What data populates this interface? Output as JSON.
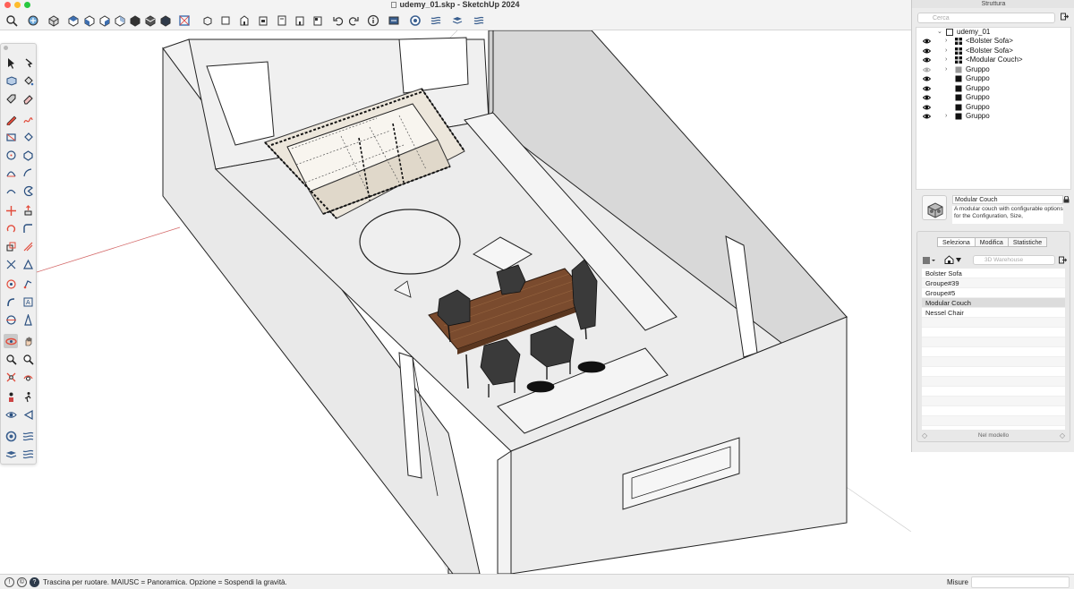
{
  "window": {
    "title": "udemy_01.skp - SketchUp 2024",
    "traffic_colors": [
      "#ff5f57",
      "#febc2e",
      "#28c840"
    ]
  },
  "toolbar": {
    "icons": [
      "search-icon",
      "component-icon",
      "iso-view-icon",
      "top-view-icon",
      "front-view-icon",
      "right-view-icon",
      "back-view-icon",
      "left-view-icon",
      "bottom-view-icon",
      "xray-icon",
      "section-plane-icon",
      "wireframe-icon",
      "hidden-line-icon",
      "shaded-icon",
      "textured-icon",
      "monochrome-icon",
      "undo-icon",
      "redo-icon",
      "entity-info-icon",
      "extension-warehouse-icon",
      "3d-warehouse-icon",
      "layers-icon",
      "outliner-icon"
    ]
  },
  "outliner": {
    "panel_title": "Struttura",
    "search_placeholder": "Cerca",
    "root": "udemy_01",
    "items": [
      {
        "label": "<Bolster Sofa>",
        "type": "component",
        "visible": true,
        "expandable": true
      },
      {
        "label": "<Bolster Sofa>",
        "type": "component",
        "visible": true,
        "expandable": true
      },
      {
        "label": "<Modular Couch>",
        "type": "component",
        "visible": true,
        "expandable": true
      },
      {
        "label": "Gruppo",
        "type": "group",
        "visible": true,
        "expandable": true
      },
      {
        "label": "Gruppo",
        "type": "group",
        "visible": true,
        "expandable": false
      },
      {
        "label": "Gruppo",
        "type": "group",
        "visible": true,
        "expandable": false
      },
      {
        "label": "Gruppo",
        "type": "group",
        "visible": true,
        "expandable": false
      },
      {
        "label": "Gruppo",
        "type": "group",
        "visible": true,
        "expandable": false
      },
      {
        "label": "Gruppo",
        "type": "group",
        "visible": true,
        "expandable": true
      }
    ]
  },
  "entity_info": {
    "name": "Modular Couch",
    "description": "A modular couch with configurable options for the Configuration, Size,"
  },
  "components": {
    "tabs": [
      "Seleziona",
      "Modifica",
      "Statistiche"
    ],
    "selected_tab": 0,
    "warehouse_placeholder": "3D Warehouse",
    "items": [
      "Bolster Sofa",
      "Groupe#39",
      "Groupe#5",
      "Modular Couch",
      "Nessel Chair"
    ],
    "selected_item": 3,
    "footer": "Nel modello"
  },
  "status": {
    "hint": "Trascina per ruotare. MAIUSC = Panoramica. Opzione = Sospendi la gravità.",
    "measure_label": "Misure",
    "measure_value": ""
  }
}
